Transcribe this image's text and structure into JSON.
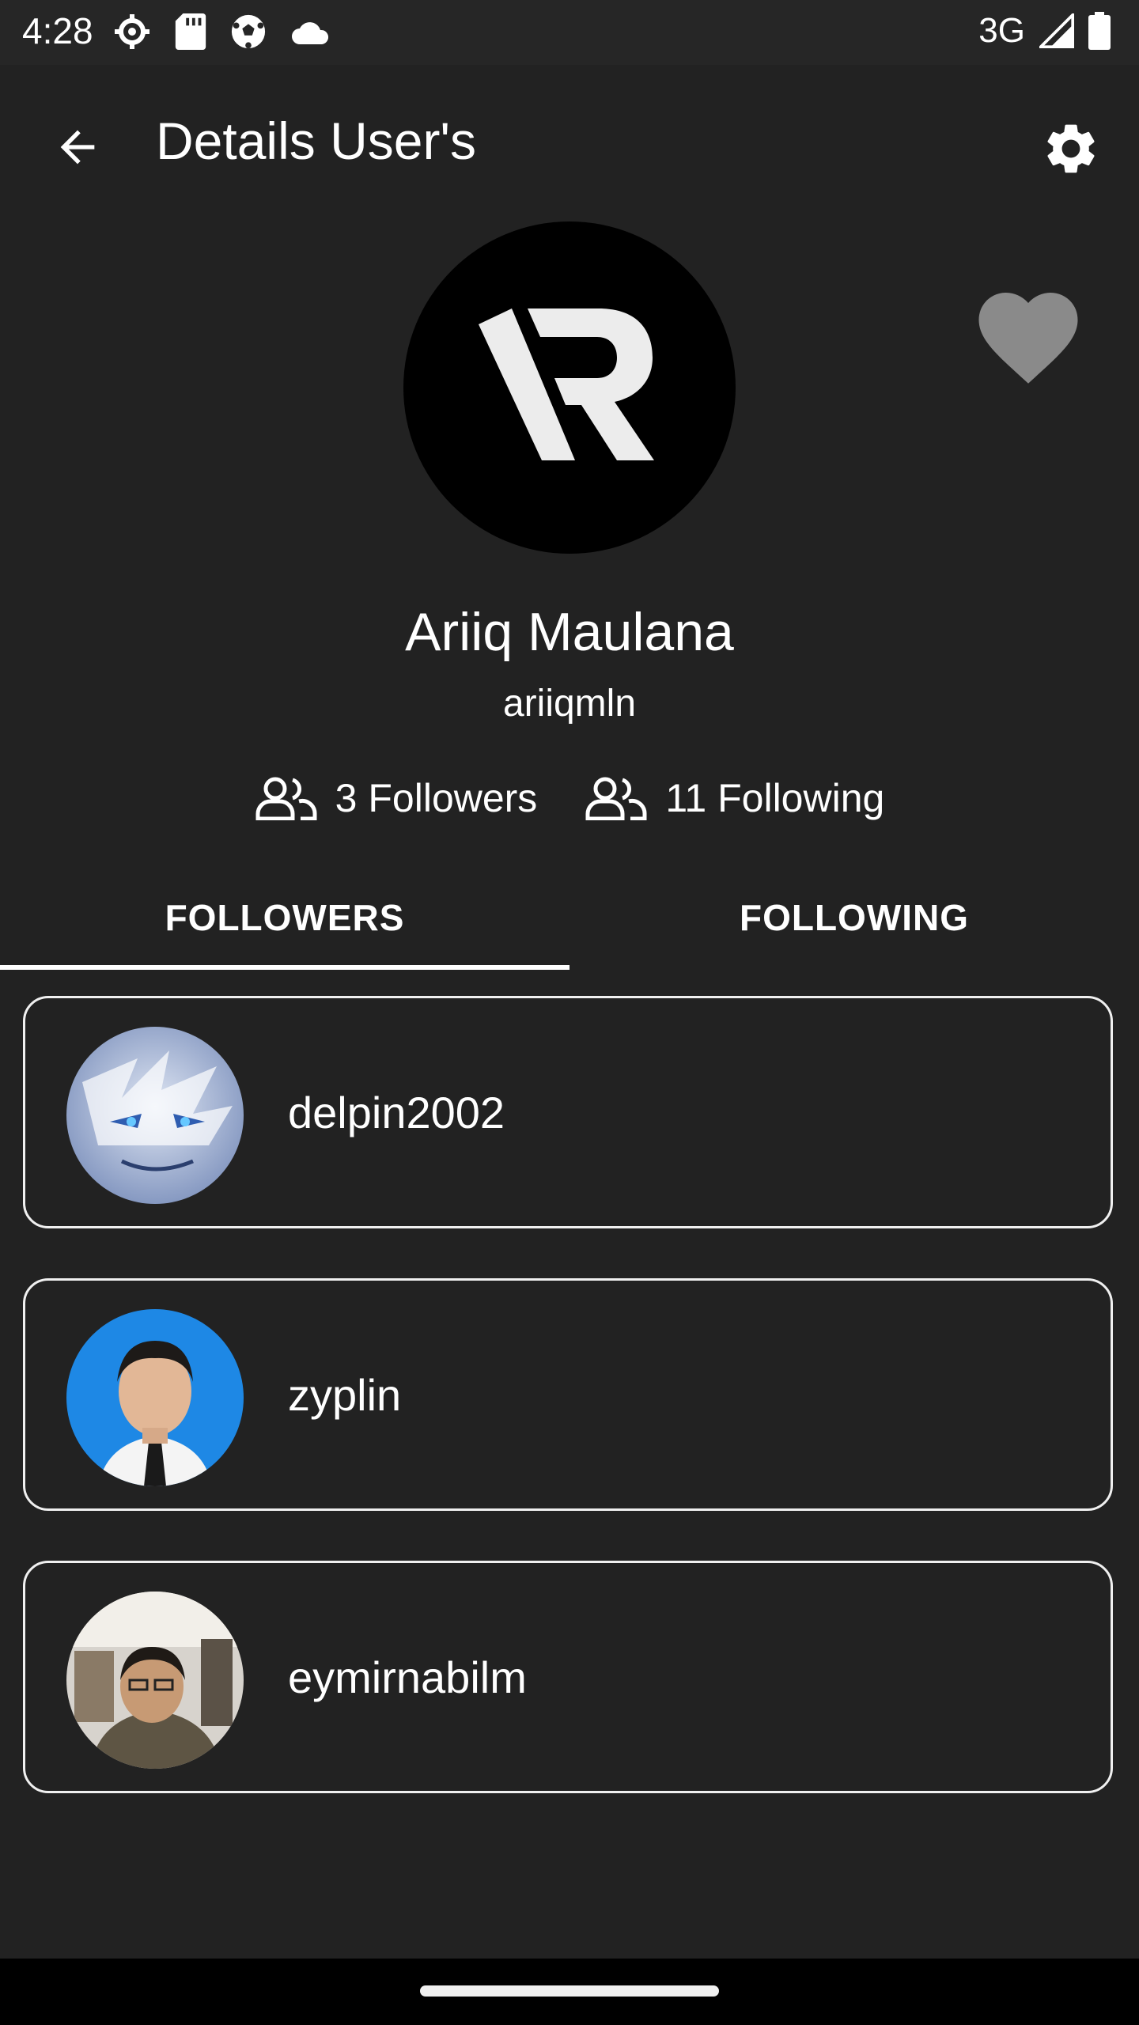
{
  "status_bar": {
    "time": "4:28",
    "network": "3G"
  },
  "app_bar": {
    "title": "Details User's"
  },
  "profile": {
    "name": "Ariiq Maulana",
    "login": "ariiqmln",
    "followers_label": "3 Followers",
    "following_label": "11 Following"
  },
  "tabs": [
    {
      "label": "FOLLOWERS",
      "selected": true
    },
    {
      "label": "FOLLOWING",
      "selected": false
    }
  ],
  "list": [
    {
      "username": "delpin2002",
      "avatar_color": "#8fa3c9"
    },
    {
      "username": "zyplin",
      "avatar_color": "#1e88e5"
    },
    {
      "username": "eymirnabilm",
      "avatar_color": "#6b5a4a"
    }
  ],
  "colors": {
    "background": "#222222",
    "status_bar": "#262626",
    "favorite_icon": "#8a8a8a"
  }
}
